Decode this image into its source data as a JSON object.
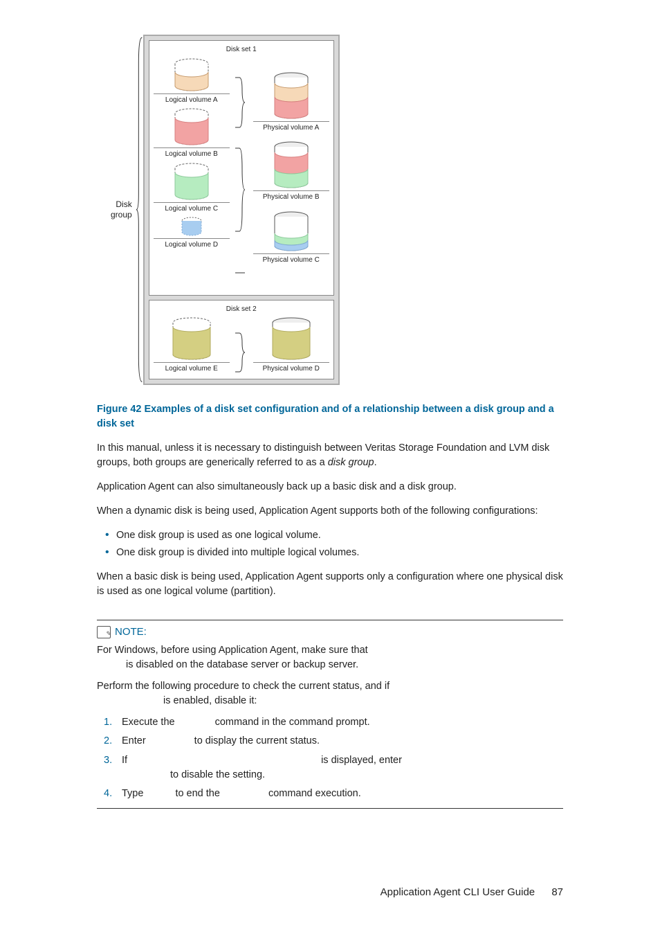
{
  "diagram": {
    "group_label_l1": "Disk",
    "group_label_l2": "group",
    "set1": {
      "title": "Disk set 1",
      "left": [
        {
          "label": "Logical volume A"
        },
        {
          "label": "Logical volume B"
        },
        {
          "label": "Logical volume C"
        },
        {
          "label": "Logical volume D"
        }
      ],
      "right": [
        {
          "label": "Physical volume A"
        },
        {
          "label": "Physical volume B"
        },
        {
          "label": "Physical volume C"
        }
      ]
    },
    "set2": {
      "title": "Disk set 2",
      "left": [
        {
          "label": "Logical volume E"
        }
      ],
      "right": [
        {
          "label": "Physical volume D"
        }
      ]
    }
  },
  "figure_caption": "Figure 42 Examples of a disk set configuration and of a relationship between a disk group and a disk set",
  "para1a": "In this manual, unless it is necessary to distinguish between Veritas Storage Foundation and LVM disk groups, both groups are generically referred to as a ",
  "para1b": "disk group",
  "para1c": ".",
  "para2": "Application Agent can also simultaneously back up a basic disk and a disk group.",
  "para3": "When a dynamic disk is being used, Application Agent supports both of the following configurations:",
  "bullets": [
    "One disk group is used as one logical volume.",
    "One disk group is divided into multiple logical volumes."
  ],
  "para4": "When a basic disk is being used, Application Agent supports only a configuration where one physical disk is used as one logical volume (partition).",
  "note": {
    "heading": "NOTE:",
    "p1_l1": "For Windows, before using Application Agent, make sure that",
    "p1_l2": "is disabled on the database server or backup server.",
    "p2_l1": "Perform the following procedure to check the current status, and if",
    "p2_l2": "is enabled, disable it:",
    "steps": [
      {
        "a": "Execute the",
        "b": "command in the command prompt."
      },
      {
        "a": "Enter",
        "b": "to display the current status."
      },
      {
        "a": "If",
        "b": "is displayed, enter",
        "c": "to disable the setting."
      },
      {
        "a": "Type",
        "b": "to end the",
        "c": "command execution."
      }
    ]
  },
  "footer": {
    "title": "Application Agent CLI User Guide",
    "page": "87"
  }
}
